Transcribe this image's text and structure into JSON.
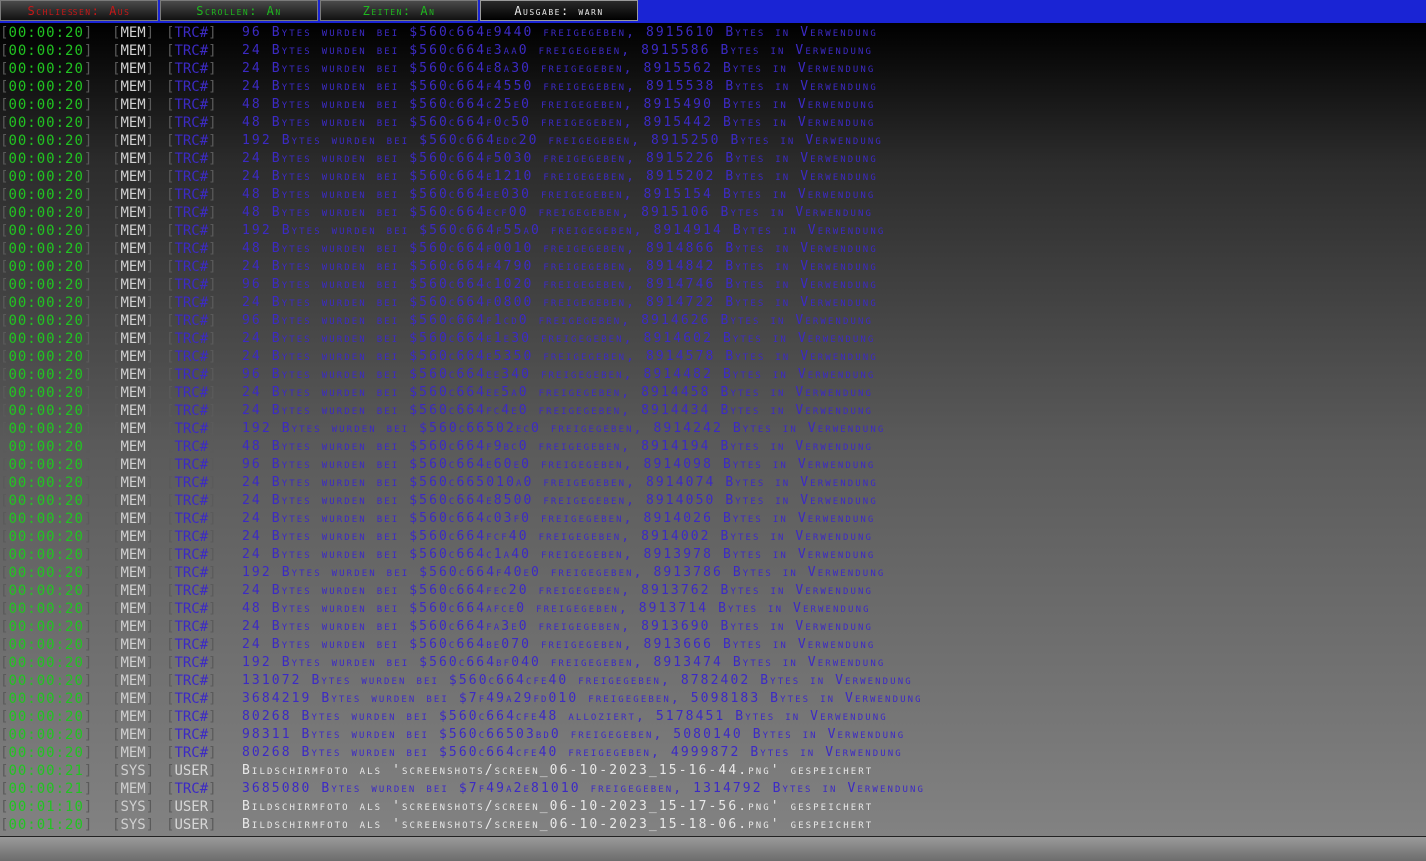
{
  "toolbar": {
    "tabs": [
      {
        "label": "Schließen: Aus",
        "color": "#c81818"
      },
      {
        "label": "Scrollen: An",
        "color": "#1fb81f"
      },
      {
        "label": "Zeiten: An",
        "color": "#1fb81f"
      },
      {
        "label": "Ausgabe: warn",
        "color": "#e6e6e6"
      }
    ]
  },
  "log": [
    {
      "time": "00:00:20",
      "src": "MEM",
      "lvl": "TRC#",
      "msg": "96 Bytes wurden bei $560c664e9440 freigegeben, 8915610 Bytes in Verwendung"
    },
    {
      "time": "00:00:20",
      "src": "MEM",
      "lvl": "TRC#",
      "msg": "24 Bytes wurden bei $560c664e3aa0 freigegeben, 8915586 Bytes in Verwendung"
    },
    {
      "time": "00:00:20",
      "src": "MEM",
      "lvl": "TRC#",
      "msg": "24 Bytes wurden bei $560c664e8a30 freigegeben, 8915562 Bytes in Verwendung"
    },
    {
      "time": "00:00:20",
      "src": "MEM",
      "lvl": "TRC#",
      "msg": "24 Bytes wurden bei $560c664f4550 freigegeben, 8915538 Bytes in Verwendung"
    },
    {
      "time": "00:00:20",
      "src": "MEM",
      "lvl": "TRC#",
      "msg": "48 Bytes wurden bei $560c664c25e0 freigegeben, 8915490 Bytes in Verwendung"
    },
    {
      "time": "00:00:20",
      "src": "MEM",
      "lvl": "TRC#",
      "msg": "48 Bytes wurden bei $560c664f0c50 freigegeben, 8915442 Bytes in Verwendung"
    },
    {
      "time": "00:00:20",
      "src": "MEM",
      "lvl": "TRC#",
      "msg": "192 Bytes wurden bei $560c664edc20 freigegeben, 8915250 Bytes in Verwendung"
    },
    {
      "time": "00:00:20",
      "src": "MEM",
      "lvl": "TRC#",
      "msg": "24 Bytes wurden bei $560c664f5030 freigegeben, 8915226 Bytes in Verwendung"
    },
    {
      "time": "00:00:20",
      "src": "MEM",
      "lvl": "TRC#",
      "msg": "24 Bytes wurden bei $560c664e1210 freigegeben, 8915202 Bytes in Verwendung"
    },
    {
      "time": "00:00:20",
      "src": "MEM",
      "lvl": "TRC#",
      "msg": "48 Bytes wurden bei $560c664ee030 freigegeben, 8915154 Bytes in Verwendung"
    },
    {
      "time": "00:00:20",
      "src": "MEM",
      "lvl": "TRC#",
      "msg": "48 Bytes wurden bei $560c664ecf00 freigegeben, 8915106 Bytes in Verwendung"
    },
    {
      "time": "00:00:20",
      "src": "MEM",
      "lvl": "TRC#",
      "msg": "192 Bytes wurden bei $560c664f55a0 freigegeben, 8914914 Bytes in Verwendung"
    },
    {
      "time": "00:00:20",
      "src": "MEM",
      "lvl": "TRC#",
      "msg": "48 Bytes wurden bei $560c664f0010 freigegeben, 8914866 Bytes in Verwendung"
    },
    {
      "time": "00:00:20",
      "src": "MEM",
      "lvl": "TRC#",
      "msg": "24 Bytes wurden bei $560c664f4790 freigegeben, 8914842 Bytes in Verwendung"
    },
    {
      "time": "00:00:20",
      "src": "MEM",
      "lvl": "TRC#",
      "msg": "96 Bytes wurden bei $560c664c1020 freigegeben, 8914746 Bytes in Verwendung"
    },
    {
      "time": "00:00:20",
      "src": "MEM",
      "lvl": "TRC#",
      "msg": "24 Bytes wurden bei $560c664f0800 freigegeben, 8914722 Bytes in Verwendung"
    },
    {
      "time": "00:00:20",
      "src": "MEM",
      "lvl": "TRC#",
      "msg": "96 Bytes wurden bei $560c664f1cd0 freigegeben, 8914626 Bytes in Verwendung"
    },
    {
      "time": "00:00:20",
      "src": "MEM",
      "lvl": "TRC#",
      "msg": "24 Bytes wurden bei $560c664e1e30 freigegeben, 8914602 Bytes in Verwendung"
    },
    {
      "time": "00:00:20",
      "src": "MEM",
      "lvl": "TRC#",
      "msg": "24 Bytes wurden bei $560c664e5350 freigegeben, 8914578 Bytes in Verwendung"
    },
    {
      "time": "00:00:20",
      "src": "MEM",
      "lvl": "TRC#",
      "msg": "96 Bytes wurden bei $560c664ee340 freigegeben, 8914482 Bytes in Verwendung"
    },
    {
      "time": "00:00:20",
      "src": "MEM",
      "lvl": "TRC#",
      "msg": "24 Bytes wurden bei $560c664ee5a0 freigegeben, 8914458 Bytes in Verwendung"
    },
    {
      "time": "00:00:20",
      "src": "MEM",
      "lvl": "TRC#",
      "msg": "24 Bytes wurden bei $560c664fc4e0 freigegeben, 8914434 Bytes in Verwendung"
    },
    {
      "time": "00:00:20",
      "src": "MEM",
      "lvl": "TRC#",
      "msg": "192 Bytes wurden bei $560c66502ec0 freigegeben, 8914242 Bytes in Verwendung"
    },
    {
      "time": "00:00:20",
      "src": "MEM",
      "lvl": "TRC#",
      "msg": "48 Bytes wurden bei $560c664f9bc0 freigegeben, 8914194 Bytes in Verwendung"
    },
    {
      "time": "00:00:20",
      "src": "MEM",
      "lvl": "TRC#",
      "msg": "96 Bytes wurden bei $560c664e60e0 freigegeben, 8914098 Bytes in Verwendung"
    },
    {
      "time": "00:00:20",
      "src": "MEM",
      "lvl": "TRC#",
      "msg": "24 Bytes wurden bei $560c665010a0 freigegeben, 8914074 Bytes in Verwendung"
    },
    {
      "time": "00:00:20",
      "src": "MEM",
      "lvl": "TRC#",
      "msg": "24 Bytes wurden bei $560c664e8500 freigegeben, 8914050 Bytes in Verwendung"
    },
    {
      "time": "00:00:20",
      "src": "MEM",
      "lvl": "TRC#",
      "msg": "24 Bytes wurden bei $560c664c03f0 freigegeben, 8914026 Bytes in Verwendung"
    },
    {
      "time": "00:00:20",
      "src": "MEM",
      "lvl": "TRC#",
      "msg": "24 Bytes wurden bei $560c664fcf40 freigegeben, 8914002 Bytes in Verwendung"
    },
    {
      "time": "00:00:20",
      "src": "MEM",
      "lvl": "TRC#",
      "msg": "24 Bytes wurden bei $560c664c1a40 freigegeben, 8913978 Bytes in Verwendung"
    },
    {
      "time": "00:00:20",
      "src": "MEM",
      "lvl": "TRC#",
      "msg": "192 Bytes wurden bei $560c664f40e0 freigegeben, 8913786 Bytes in Verwendung"
    },
    {
      "time": "00:00:20",
      "src": "MEM",
      "lvl": "TRC#",
      "msg": "24 Bytes wurden bei $560c664fec20 freigegeben, 8913762 Bytes in Verwendung"
    },
    {
      "time": "00:00:20",
      "src": "MEM",
      "lvl": "TRC#",
      "msg": "48 Bytes wurden bei $560c664afce0 freigegeben, 8913714 Bytes in Verwendung"
    },
    {
      "time": "00:00:20",
      "src": "MEM",
      "lvl": "TRC#",
      "msg": "24 Bytes wurden bei $560c664fa3e0 freigegeben, 8913690 Bytes in Verwendung"
    },
    {
      "time": "00:00:20",
      "src": "MEM",
      "lvl": "TRC#",
      "msg": "24 Bytes wurden bei $560c664be070 freigegeben, 8913666 Bytes in Verwendung"
    },
    {
      "time": "00:00:20",
      "src": "MEM",
      "lvl": "TRC#",
      "msg": "192 Bytes wurden bei $560c664bf040 freigegeben, 8913474 Bytes in Verwendung"
    },
    {
      "time": "00:00:20",
      "src": "MEM",
      "lvl": "TRC#",
      "msg": "131072 Bytes wurden bei $560c664cfe40 freigegeben, 8782402 Bytes in Verwendung"
    },
    {
      "time": "00:00:20",
      "src": "MEM",
      "lvl": "TRC#",
      "msg": "3684219 Bytes wurden bei $7f49a29fd010 freigegeben, 5098183 Bytes in Verwendung"
    },
    {
      "time": "00:00:20",
      "src": "MEM",
      "lvl": "TRC#",
      "msg": "80268 Bytes wurden bei $560c664cfe48 alloziert, 5178451 Bytes in Verwendung"
    },
    {
      "time": "00:00:20",
      "src": "MEM",
      "lvl": "TRC#",
      "msg": "98311 Bytes wurden bei $560c66503bd0 freigegeben, 5080140 Bytes in Verwendung"
    },
    {
      "time": "00:00:20",
      "src": "MEM",
      "lvl": "TRC#",
      "msg": "80268 Bytes wurden bei $560c664cfe40 freigegeben, 4999872 Bytes in Verwendung"
    },
    {
      "time": "00:00:21",
      "src": "SYS",
      "lvl": "USER",
      "msg": "Bildschirmfoto als 'screenshots/screen_06-10-2023_15-16-44.png' gespeichert"
    },
    {
      "time": "00:00:21",
      "src": "MEM",
      "lvl": "TRC#",
      "msg": "3685080 Bytes wurden bei $7f49a2e81010 freigegeben, 1314792 Bytes in Verwendung"
    },
    {
      "time": "00:01:10",
      "src": "SYS",
      "lvl": "USER",
      "msg": "Bildschirmfoto als 'screenshots/screen_06-10-2023_15-17-56.png' gespeichert"
    },
    {
      "time": "00:01:20",
      "src": "SYS",
      "lvl": "USER",
      "msg": "Bildschirmfoto als 'screenshots/screen_06-10-2023_15-18-06.png' gespeichert"
    }
  ],
  "colors": {
    "topbar": "#1a24d4",
    "timestamp": "#21c421",
    "trace": "#3c2ac4",
    "user": "#e8e8e8"
  }
}
